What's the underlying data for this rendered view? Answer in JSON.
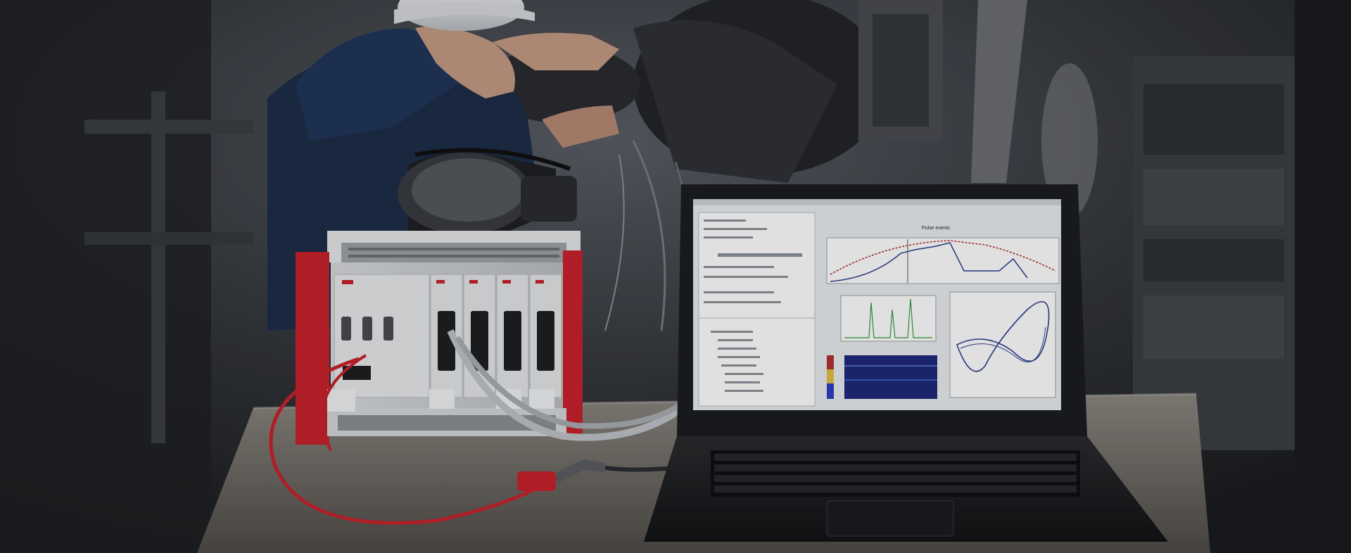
{
  "scene": {
    "description_kind": "photograph",
    "palette": {
      "background": "#2a2c30",
      "accent_red": "#c8232c",
      "metal": "#c9ccd1",
      "screen_bg": "#e9ecef",
      "plot_blue": "#2b3f8f",
      "plot_red": "#b02a2a",
      "plot_green": "#2f9a3f"
    }
  },
  "laptop_screen": {
    "plot_title": "Pulse events"
  }
}
